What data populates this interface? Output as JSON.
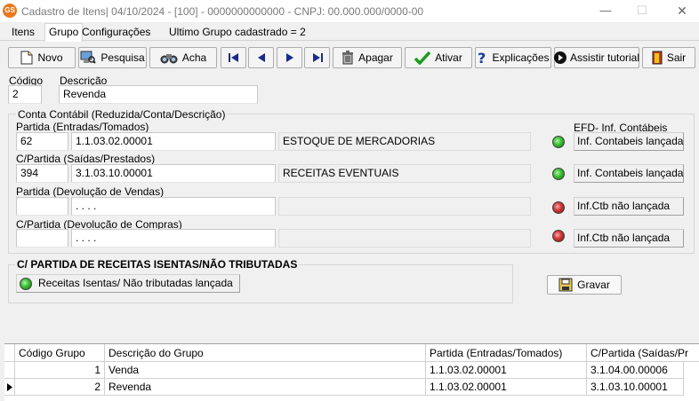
{
  "window": {
    "icon_text": "GS",
    "title": "Cadastro de Itens| 04/10/2024 - [100] - 0000000000000 - CNPJ: 00.000.000/0000-00",
    "minimize": "—",
    "maximize": "☐",
    "close": "✕"
  },
  "tabs": [
    {
      "label": "Itens"
    },
    {
      "label": "Grupo"
    },
    {
      "label": "Configurações"
    }
  ],
  "last_group_label": "Ultimo Grupo cadastrado = 2",
  "toolbar": {
    "novo": "Novo",
    "pesquisa": "Pesquisa",
    "acha": "Acha",
    "apagar": "Apagar",
    "ativar": "Ativar",
    "explicacoes": "Explicações",
    "assistir": "Assistir tutorial",
    "sair": "Sair"
  },
  "form": {
    "codigo_label": "Código",
    "codigo_value": "2",
    "descricao_label": "Descrição",
    "descricao_value": "Revenda",
    "conta_group_label": "Conta Contábil (Reduzida/Conta/Descrição)",
    "efd_label": "EFD- Inf. Contábeis",
    "rows": [
      {
        "label": "Partida (Entradas/Tomados)",
        "reduzida": "62",
        "conta": "1.1.03.02.00001",
        "descricao": "ESTOQUE DE MERCADORIAS",
        "status": "green",
        "button": "Inf. Contabeis lançada"
      },
      {
        "label": "C/Partida (Saídas/Prestados)",
        "reduzida": "394",
        "conta": "3.1.03.10.00001",
        "descricao": "RECEITAS EVENTUAIS",
        "status": "green",
        "button": "Inf. Contabeis lançada"
      },
      {
        "label": "Partida (Devolução de Vendas)",
        "reduzida": "",
        "conta": ". . . .",
        "descricao": "",
        "status": "red",
        "button": "Inf.Ctb não lançada"
      },
      {
        "label": "C/Partida (Devolução de Compras)",
        "reduzida": "",
        "conta": ". . . .",
        "descricao": "",
        "status": "red",
        "button": "Inf.Ctb não lançada"
      }
    ],
    "isentas_label": "C/ PARTIDA DE RECEITAS ISENTAS/NÃO TRIBUTADAS",
    "isentas_button": "Receitas Isentas/ Não tributadas lançada",
    "gravar": "Gravar"
  },
  "grid": {
    "columns": [
      "Código Grupo",
      "Descrição do Grupo",
      "Partida (Entradas/Tomados)",
      "C/Partida (Saídas/Pr"
    ],
    "rows": [
      {
        "codigo": "1",
        "descricao": "Venda",
        "partida": "1.1.03.02.00001",
        "cpartida": "3.1.04.00.00006"
      },
      {
        "codigo": "2",
        "descricao": "Revenda",
        "partida": "1.1.03.02.00001",
        "cpartida": "3.1.03.10.00001"
      }
    ]
  },
  "colors": {
    "accent_green": "#3ec43a",
    "accent_red": "#d83a3a",
    "window_bg": "#f0f0f0"
  }
}
